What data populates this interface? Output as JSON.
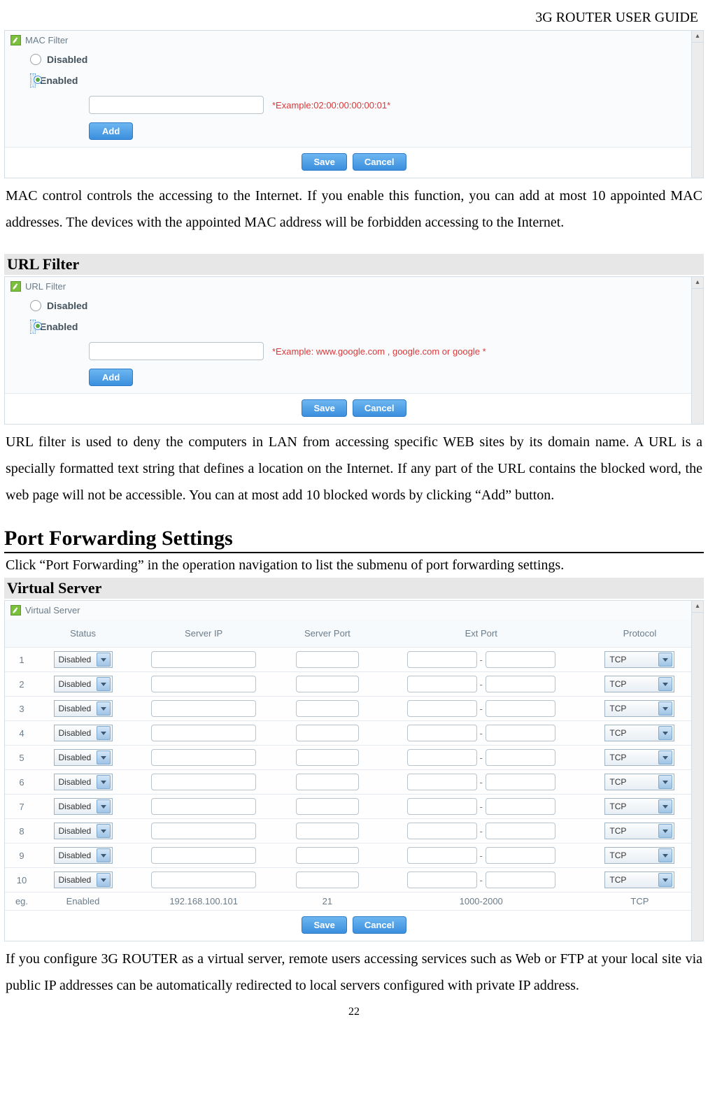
{
  "header": {
    "doc_title": "3G ROUTER USER GUIDE"
  },
  "mac_panel": {
    "title": "MAC Filter",
    "disabled_label": "Disabled",
    "enabled_label": "Enabled",
    "example": "*Example:02:00:00:00:00:01*",
    "add_label": "Add",
    "save_label": "Save",
    "cancel_label": "Cancel"
  },
  "mac_para": "MAC control controls the accessing to the Internet. If you enable this function, you can add at most 10 appointed MAC addresses. The devices with the appointed MAC address will be forbidden accessing to the Internet.",
  "url_section_title": "URL Filter",
  "url_panel": {
    "title": "URL Filter",
    "disabled_label": "Disabled",
    "enabled_label": "Enabled",
    "example": "*Example: www.google.com , google.com or google *",
    "add_label": "Add",
    "save_label": "Save",
    "cancel_label": "Cancel"
  },
  "url_para": "URL filter is used to deny the computers in LAN from accessing specific WEB sites by its domain name. A URL is a specially formatted text string that defines a location on the Internet. If any part of the URL contains the blocked word, the web page will not be accessible. You can at most add 10 blocked words by clicking “Add” button.",
  "pfs_heading": "Port Forwarding Settings",
  "pfs_intro": "Click “Port Forwarding” in the operation navigation to list the submenu of port forwarding settings.",
  "vs_section_title": "Virtual Server",
  "vs_panel": {
    "title": "Virtual Server",
    "headers": {
      "status": "Status",
      "server_ip": "Server IP",
      "server_port": "Server Port",
      "ext_port": "Ext Port",
      "protocol": "Protocol"
    },
    "status_value": "Disabled",
    "protocol_value": "TCP",
    "row_ids": [
      "1",
      "2",
      "3",
      "4",
      "5",
      "6",
      "7",
      "8",
      "9",
      "10"
    ],
    "eg": {
      "label": "eg.",
      "status": "Enabled",
      "ip": "192.168.100.101",
      "port": "21",
      "ext": "1000-2000",
      "proto": "TCP"
    },
    "save_label": "Save",
    "cancel_label": "Cancel",
    "range_sep": "-"
  },
  "vs_para": "If you configure 3G ROUTER as a virtual server, remote users accessing services such as Web or FTP at your local site via public IP addresses can be automatically redirected to local servers configured with private IP address.",
  "page_number": "22"
}
